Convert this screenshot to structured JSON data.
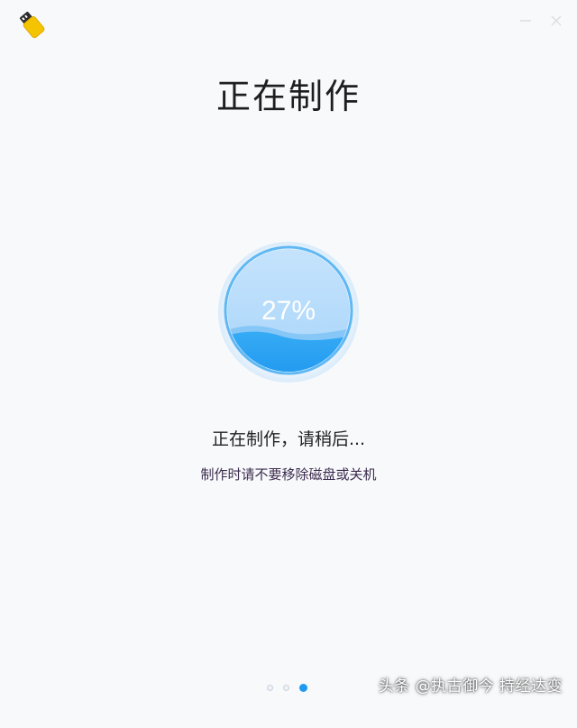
{
  "window": {
    "icon": "usb-drive-icon",
    "controls": [
      "minimize-icon",
      "close-icon"
    ]
  },
  "page": {
    "title": "正在制作",
    "status": "正在制作，请稍后...",
    "hint": "制作时请不要移除磁盘或关机"
  },
  "progress": {
    "label": "27%",
    "value": 0.27,
    "colors": {
      "ring": "#5fb8f3",
      "fill_light": "#b9dcfa",
      "wave_front": "#2aa4f4",
      "wave_back": "#8ccaf7"
    }
  },
  "pager": {
    "pages": 3,
    "current": 3,
    "active_color": "#1e9bf0"
  },
  "watermark": "头条 @执古御今 持经达变"
}
